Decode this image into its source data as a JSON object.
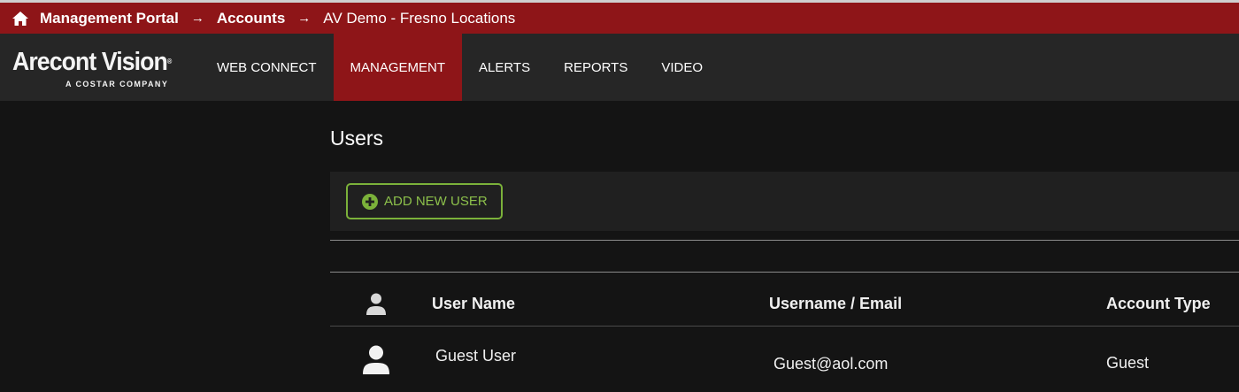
{
  "breadcrumb": {
    "items": [
      {
        "label": "Management Portal"
      },
      {
        "label": "Accounts"
      },
      {
        "label": "AV Demo - Fresno Locations"
      }
    ],
    "separator": "→"
  },
  "logo": {
    "brand": "Arecont Vision",
    "registered": "®",
    "tagline": "A COSTAR COMPANY"
  },
  "nav": {
    "items": [
      {
        "label": "WEB CONNECT",
        "active": false
      },
      {
        "label": "MANAGEMENT",
        "active": true
      },
      {
        "label": "ALERTS",
        "active": false
      },
      {
        "label": "REPORTS",
        "active": false
      },
      {
        "label": "VIDEO",
        "active": false
      }
    ]
  },
  "page": {
    "title": "Users"
  },
  "toolbar": {
    "add_user_label": "ADD NEW USER"
  },
  "table": {
    "columns": [
      "User Name",
      "Username / Email",
      "Account Type"
    ],
    "rows": [
      {
        "name": "Guest User",
        "email": "Guest@aol.com",
        "type": "Guest"
      }
    ]
  },
  "colors": {
    "brand_red": "#8e1518",
    "accent_green": "#7bb13a",
    "nav_bg": "#262626",
    "page_bg": "#141414"
  },
  "icons": {
    "home": "home-icon",
    "add": "plus-circle-icon",
    "user": "user-icon"
  }
}
